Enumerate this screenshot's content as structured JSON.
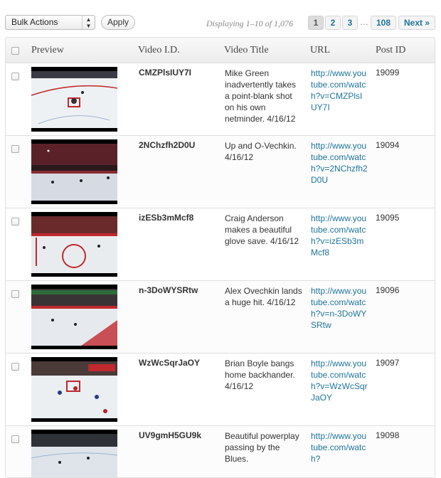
{
  "toolbar": {
    "bulk_actions": "Bulk Actions",
    "apply": "Apply",
    "displaying": "Displaying 1–10 of 1,076",
    "pages": [
      "1",
      "2",
      "3"
    ],
    "ellipsis": "…",
    "last_page": "108",
    "next": "Next »"
  },
  "table": {
    "headers": {
      "preview": "Preview",
      "video_id": "Video I.D.",
      "video_title": "Video Title",
      "url": "URL",
      "post_id": "Post ID"
    },
    "rows": [
      {
        "video_id": "CMZPlsIUY7I",
        "title": "Mike Green inadvertently takes a point-blank shot on his own netminder. 4/16/12",
        "url": "http://www.youtube.com/watch?v=CMZPlsIUY7I",
        "post_id": "19099"
      },
      {
        "video_id": "2NChzfh2D0U",
        "title": "Up and O-Vechkin. 4/16/12",
        "url": "http://www.youtube.com/watch?v=2NChzfh2D0U",
        "post_id": "19094"
      },
      {
        "video_id": "izESb3mMcf8",
        "title": "Craig Anderson makes a beautiful glove save. 4/16/12",
        "url": "http://www.youtube.com/watch?v=izESb3mMcf8",
        "post_id": "19095"
      },
      {
        "video_id": "n-3DoWYSRtw",
        "title": "Alex Ovechkin lands a huge hit. 4/16/12",
        "url": "http://www.youtube.com/watch?v=n-3DoWYSRtw",
        "post_id": "19096"
      },
      {
        "video_id": "WzWcSqrJaOY",
        "title": "Brian Boyle bangs home backhander. 4/16/12",
        "url": "http://www.youtube.com/watch?v=WzWcSqrJaOY",
        "post_id": "19097"
      },
      {
        "video_id": "UV9gmH5GU9k",
        "title": "Beautiful powerplay passing by the Blues.",
        "url": "http://www.youtube.com/watch?",
        "post_id": "19098"
      }
    ]
  },
  "colors": {
    "link": "#21759b",
    "ice": "#eef1f4",
    "rink_red": "#c0282d"
  }
}
